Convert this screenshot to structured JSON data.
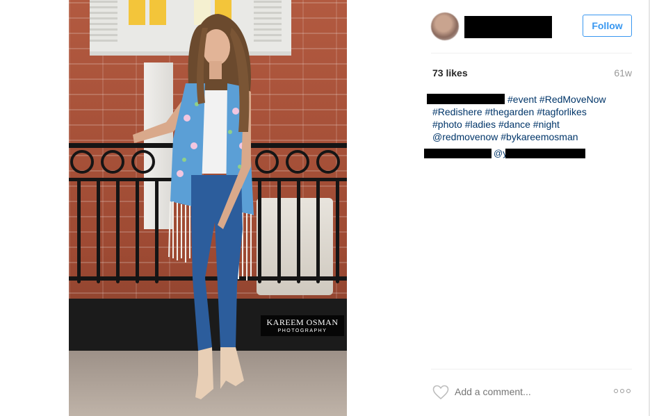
{
  "post": {
    "photo_alt": "Woman posing by a railing",
    "watermark": {
      "line1": "KAREEM OSMAN",
      "line2": "PHOTOGRAPHY"
    }
  },
  "header": {
    "follow_label": "Follow"
  },
  "stats": {
    "likes": "73 likes",
    "time_ago": "61w"
  },
  "caption": {
    "tags": [
      "#event",
      "#RedMoveNow",
      "#Redishere",
      "#thegarden",
      "#tagforlikes",
      "#photo",
      "#ladies",
      "#dance",
      "#night",
      "@redmovenow",
      "#bykareemosman"
    ],
    "line1_tail": "#event #RedMoveNow",
    "line2": "#Redishere #thegarden #tagforlikes",
    "line3": "#photo #ladies #dance #night",
    "line4": "@redmovenow #bykareemosman"
  },
  "comment": {
    "mention_fragment": "@y"
  },
  "comment_bar": {
    "placeholder": "Add a comment..."
  },
  "icons": {
    "heart": "heart-icon",
    "more": "more-options-icon"
  },
  "colors": {
    "link": "#003569",
    "follow_blue": "#3897f0",
    "muted": "#999999"
  }
}
